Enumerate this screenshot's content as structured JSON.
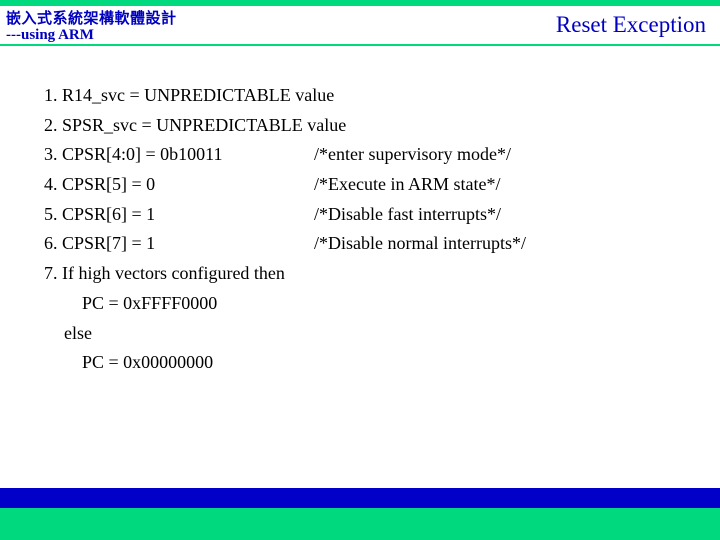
{
  "header": {
    "title_cn": "嵌入式系統架構軟體設計",
    "title_en": "---using ARM",
    "title_right": "Reset Exception"
  },
  "content": {
    "line1": "1. R14_svc = UNPREDICTABLE value",
    "line2": "2. SPSR_svc = UNPREDICTABLE value",
    "line3_left": "3. CPSR[4:0] = 0b10011",
    "line3_right": "/*enter supervisory mode*/",
    "line4_left": "4. CPSR[5] = 0",
    "line4_right": "/*Execute in ARM state*/",
    "line5_left": "5. CPSR[6] = 1",
    "line5_right": "/*Disable fast interrupts*/",
    "line6_left": "6. CPSR[7] = 1",
    "line6_right": "/*Disable normal interrupts*/",
    "line7": "7. If high vectors configured then",
    "line8": "  PC = 0xFFFF0000",
    "line9": " else",
    "line10": "  PC = 0x00000000"
  }
}
